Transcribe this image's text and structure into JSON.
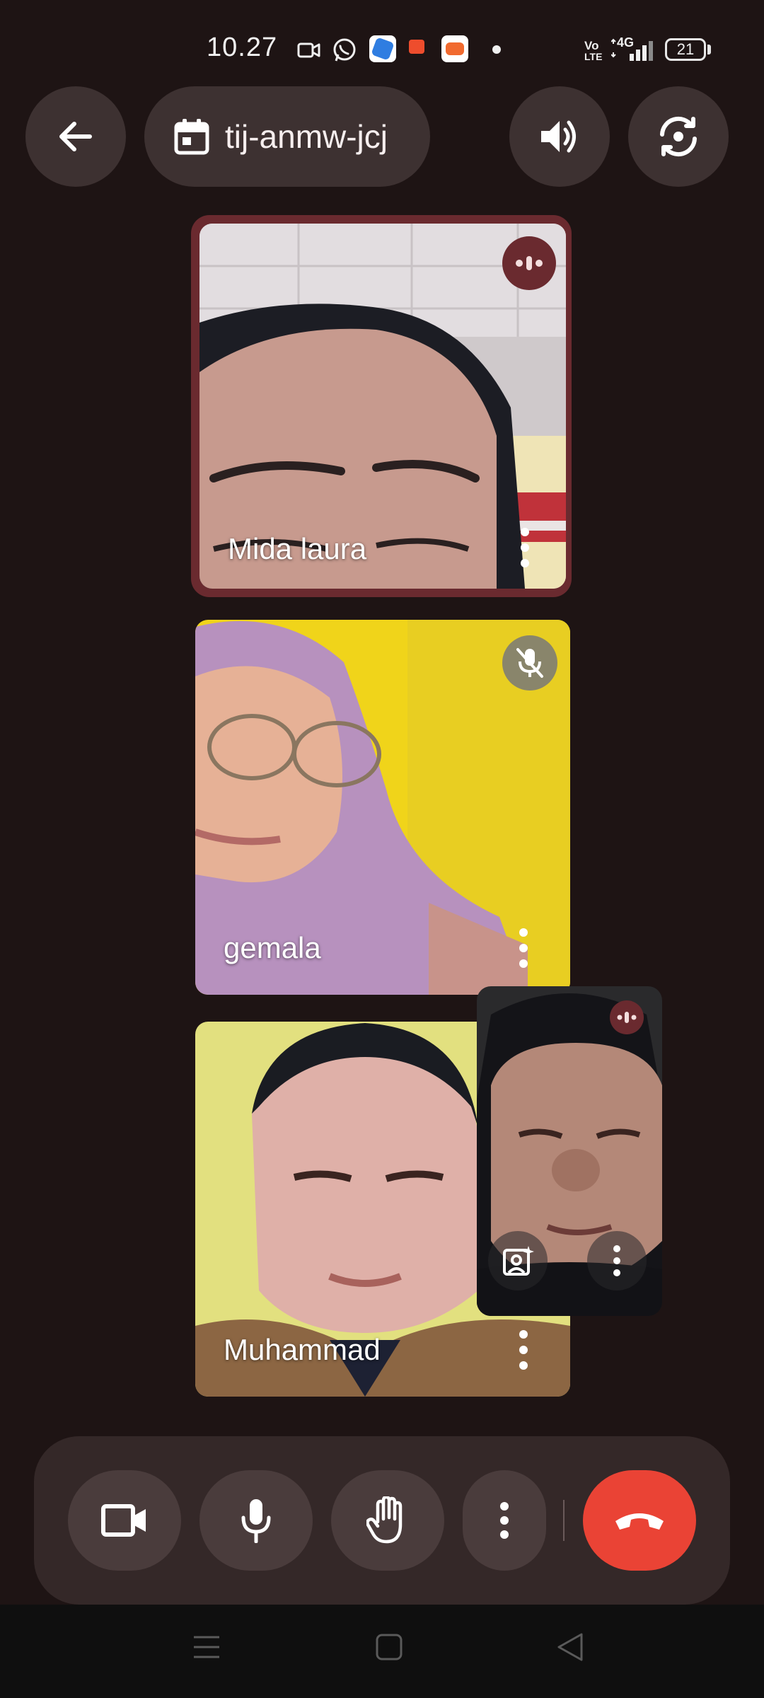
{
  "status_bar": {
    "time": "10.27",
    "network_label": "4G",
    "volte_top": "Vo",
    "volte_bottom": "LTE",
    "battery": "21",
    "app_icons": [
      "video-notification-icon",
      "whatsapp-icon",
      "blue-app-icon",
      "shopeepay-icon",
      "game-app-icon"
    ]
  },
  "header": {
    "meeting_code": "tij-anmw-jcj"
  },
  "participants": [
    {
      "name": "Mida laura",
      "speaking": true,
      "muted": false
    },
    {
      "name": "gemala",
      "speaking": false,
      "muted": true
    },
    {
      "name": "Muhammad",
      "speaking": false,
      "muted": false
    }
  ],
  "self_view": {
    "speaking": true
  },
  "colors": {
    "background": "#1e1414",
    "surface": "#3d3131",
    "control_button": "#4a3c3c",
    "end_call": "#ea4335",
    "speaking_accent": "#6a2a2f"
  }
}
